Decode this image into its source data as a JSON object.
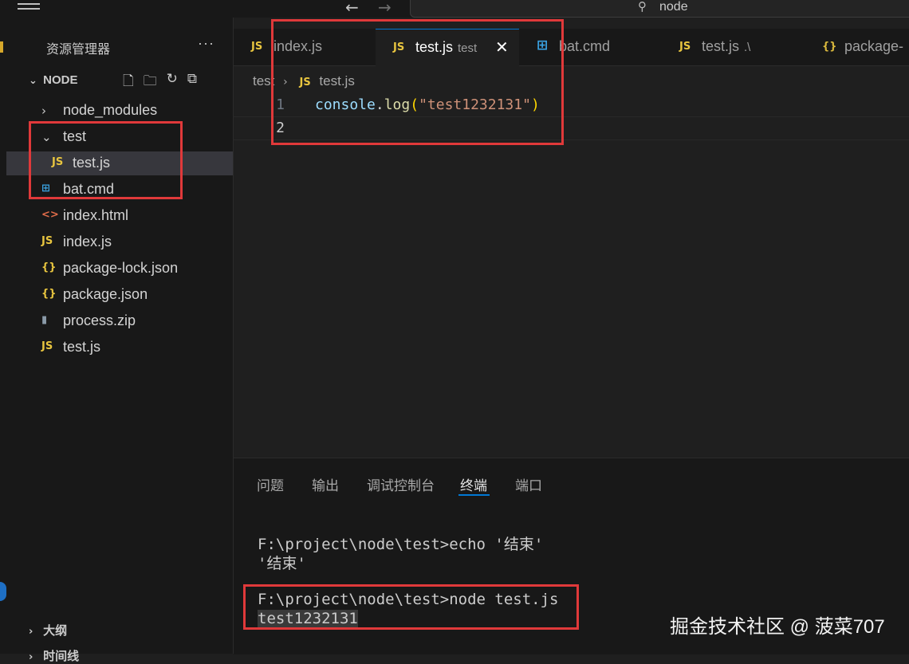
{
  "titlebar": {
    "back": "←",
    "forward": "→",
    "search_icon": "⚲",
    "search_text": "node"
  },
  "sidebar": {
    "title": "资源管理器",
    "more": "···",
    "root_folder": "NODE",
    "actions": [
      "new-file-icon",
      "new-folder-icon",
      "refresh-icon",
      "collapse-icon"
    ],
    "items": [
      {
        "label": "node_modules",
        "icon": "›",
        "icon_name": "chevron-right-icon",
        "indent": 1
      },
      {
        "label": "test",
        "icon": "⌄",
        "icon_name": "chevron-down-icon",
        "indent": 1
      },
      {
        "label": "test.js",
        "icon": "JS",
        "icon_name": "js-file-icon",
        "indent": 2,
        "selected": true
      },
      {
        "label": "bat.cmd",
        "icon": "⊞",
        "icon_name": "windows-cmd-icon",
        "indent": 1
      },
      {
        "label": "index.html",
        "icon": "<>",
        "icon_name": "html-file-icon",
        "indent": 1
      },
      {
        "label": "index.js",
        "icon": "JS",
        "icon_name": "js-file-icon",
        "indent": 1
      },
      {
        "label": "package-lock.json",
        "icon": "{}",
        "icon_name": "json-file-icon",
        "indent": 1
      },
      {
        "label": "package.json",
        "icon": "{}",
        "icon_name": "json-file-icon",
        "indent": 1
      },
      {
        "label": "process.zip",
        "icon": "▮",
        "icon_name": "zip-file-icon",
        "indent": 1
      },
      {
        "label": "test.js",
        "icon": "JS",
        "icon_name": "js-file-icon",
        "indent": 1
      }
    ],
    "outline": "大纲",
    "timeline": "时间线"
  },
  "tabs": [
    {
      "label": "index.js",
      "icon": "JS"
    },
    {
      "label": "test.js",
      "desc": "test",
      "icon": "JS",
      "active": true,
      "close": "✕"
    },
    {
      "label": "bat.cmd",
      "icon": "⊞"
    },
    {
      "label": "test.js",
      "desc": ".\\",
      "icon": "JS"
    },
    {
      "label": "package-",
      "icon": "{}"
    }
  ],
  "breadcrumb": {
    "folder": "test",
    "separator": "›",
    "file_icon": "JS",
    "file": "test.js"
  },
  "editor": {
    "lines": [
      {
        "num": "1",
        "tokens": [
          "console",
          ".",
          "log",
          "(",
          "\"test1232131\"",
          ")"
        ]
      },
      {
        "num": "2",
        "tokens": []
      }
    ]
  },
  "panel": {
    "tabs": [
      "问题",
      "输出",
      "调试控制台",
      "终端",
      "端口"
    ],
    "active_tab": "终端",
    "terminal": [
      "F:\\project\\node\\test>echo '结束'",
      "'结束'",
      "F:\\project\\node\\test>node test.js",
      "test1232131"
    ]
  },
  "watermark": "掘金技术社区 @ 菠菜707",
  "colors": {
    "annotation": "#e0393a",
    "accent": "#0078d4",
    "js_icon": "#e8c53f"
  }
}
